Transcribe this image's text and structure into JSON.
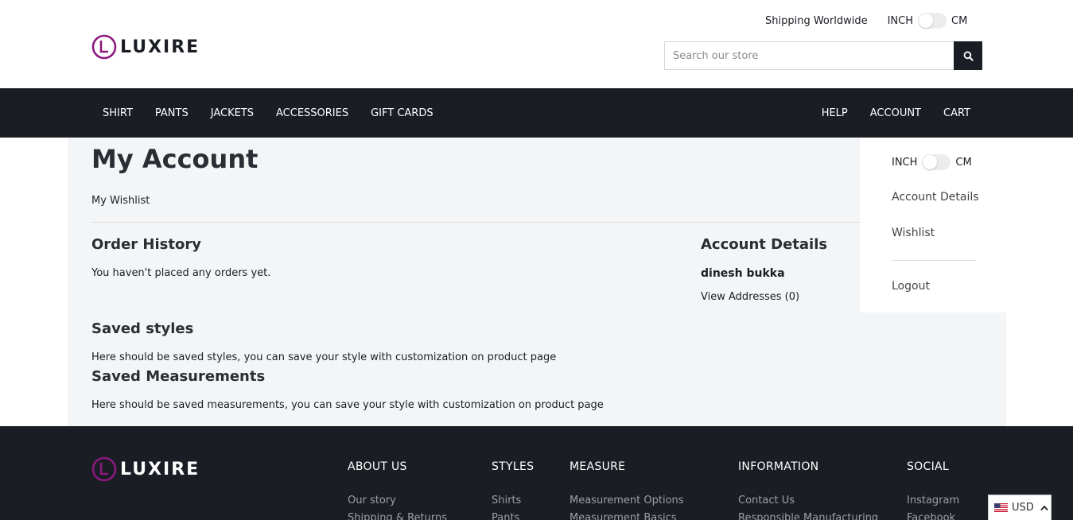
{
  "header": {
    "logo_text": "LUXIRE",
    "shipping": "Shipping Worldwide",
    "unit_left": "INCH",
    "unit_right": "CM",
    "search_placeholder": "Search our store"
  },
  "nav": {
    "left": [
      "SHIRT",
      "PANTS",
      "JACKETS",
      "ACCESSORIES",
      "GIFT CARDS"
    ],
    "right": [
      "HELP",
      "ACCOUNT",
      "CART"
    ]
  },
  "main": {
    "title": "My Account",
    "wishlist_link": "My Wishlist",
    "order_history": {
      "heading": "Order History",
      "text": "You haven't placed any orders yet."
    },
    "account_details": {
      "heading": "Account Details",
      "name": "dinesh bukka",
      "addresses": "View Addresses (0)"
    },
    "saved_styles": {
      "heading": "Saved styles",
      "text": "Here should be saved styles, you can save your style with customization on product page"
    },
    "saved_measurements": {
      "heading": "Saved Measurements",
      "text": "Here should be saved measurements, you can save your style with customization on product page"
    }
  },
  "account_menu": {
    "unit_left": "INCH",
    "unit_right": "CM",
    "account_details": "Account Details",
    "wishlist": "Wishlist",
    "logout": "Logout"
  },
  "footer": {
    "logo_text": "LUXIRE",
    "columns": [
      {
        "title": "ABOUT US",
        "links": [
          "Our story",
          "Shipping & Returns"
        ]
      },
      {
        "title": "STYLES",
        "links": [
          "Shirts",
          "Pants"
        ]
      },
      {
        "title": "MEASURE",
        "links": [
          "Measurement Options",
          "Measurement Basics"
        ]
      },
      {
        "title": "INFORMATION",
        "links": [
          "Contact Us",
          "Responsible Manufacturing"
        ]
      },
      {
        "title": "SOCIAL",
        "links": [
          "Instagram",
          "Facebook"
        ]
      }
    ]
  },
  "currency": {
    "code": "USD"
  },
  "colors": {
    "dark": "#1a1d23",
    "brand_purple": "#8b1a7e",
    "page_bg": "#f4f5f7"
  }
}
